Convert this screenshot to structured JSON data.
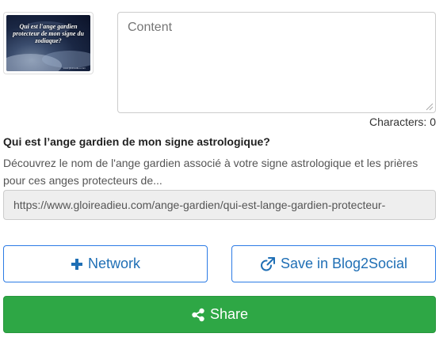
{
  "thumbnail": {
    "caption": "Qui est l'ange gardien protecteur de mon signe du zodiaque?",
    "footer": "www.gloireadieu.com"
  },
  "composer": {
    "content_placeholder": "Content",
    "char_count_label": "Characters: 0"
  },
  "link_preview": {
    "title": "Qui est l’ange gardien de mon signe astrologique?",
    "description": "Découvrez le nom de l'ange gardien associé à votre signe astrologique et les prières pour ces anges protecteurs de...",
    "url": "https://www.gloireadieu.com/ange-gardien/qui-est-lange-gardien-protecteur-"
  },
  "actions": {
    "network_label": "Network",
    "save_label": "Save in Blog2Social",
    "share_label": "Share"
  },
  "colors": {
    "primary_blue": "#2c7be5",
    "share_green": "#2ea745"
  },
  "icons": {
    "network": "plus-icon",
    "save": "external-link-icon",
    "share": "share-icon"
  }
}
